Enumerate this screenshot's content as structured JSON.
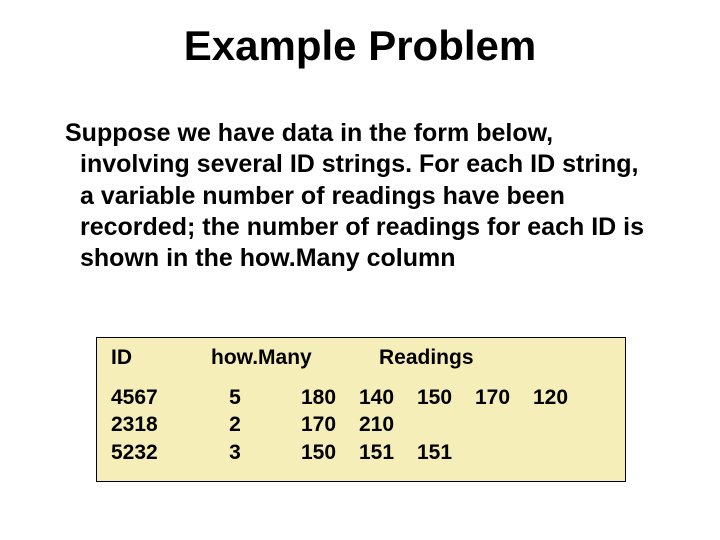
{
  "title": "Example Problem",
  "body": "Suppose we have data in the form below, involving several ID strings.  For each ID string, a variable number of readings have been recorded; the number of readings for each ID is shown in the how.Many column",
  "table": {
    "headers": {
      "id": "ID",
      "howMany": "how.Many",
      "readings": "Readings"
    },
    "rows": [
      {
        "id": "4567",
        "howMany": "5",
        "r": [
          "180",
          "140",
          "150",
          "170",
          "120"
        ]
      },
      {
        "id": "2318",
        "howMany": "2",
        "r": [
          "170",
          "210",
          "",
          "",
          ""
        ]
      },
      {
        "id": "5232",
        "howMany": "3",
        "r": [
          "150",
          "151",
          "151",
          "",
          ""
        ]
      }
    ]
  }
}
